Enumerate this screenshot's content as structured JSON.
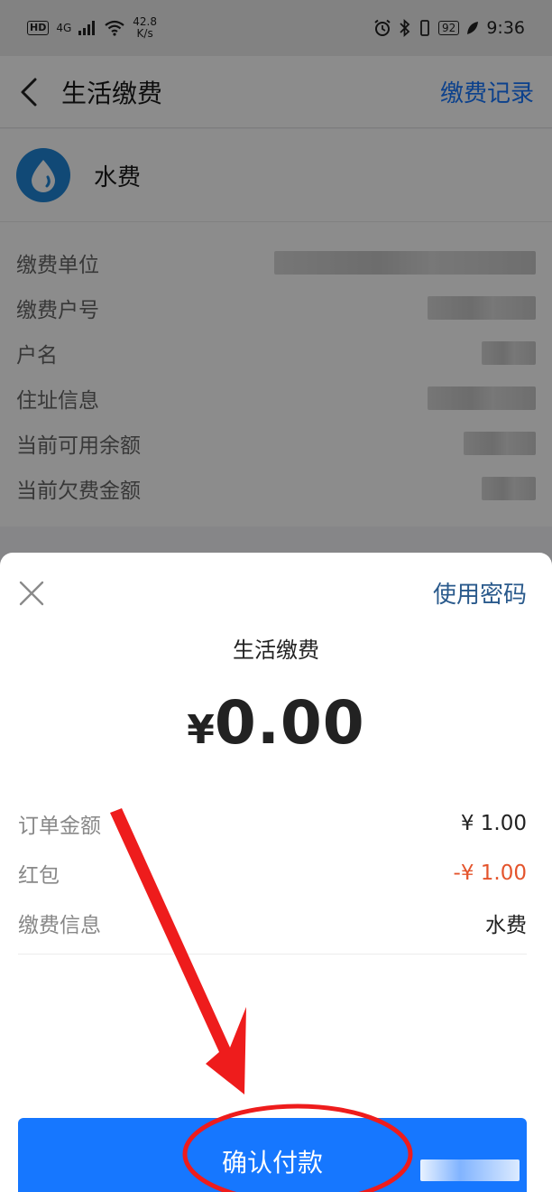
{
  "status_bar": {
    "hd": "HD",
    "net": "4G",
    "speed_value": "42.8",
    "speed_unit": "K/s",
    "battery": "92",
    "time": "9:36"
  },
  "header": {
    "title": "生活缴费",
    "records_link": "缴费记录"
  },
  "biller": {
    "name": "水费",
    "icon": "water-drop-icon"
  },
  "info_rows": [
    {
      "label": "缴费单位"
    },
    {
      "label": "缴费户号"
    },
    {
      "label": "户名"
    },
    {
      "label": "住址信息"
    },
    {
      "label": "当前可用余额"
    },
    {
      "label": "当前欠费金额"
    }
  ],
  "sheet": {
    "use_password": "使用密码",
    "title": "生活缴费",
    "currency": "¥",
    "amount": "0.00",
    "details": [
      {
        "label": "订单金额",
        "value": "¥ 1.00",
        "color": "#222222"
      },
      {
        "label": "红包",
        "value": "-¥ 1.00",
        "color": "#e4542c"
      },
      {
        "label": "缴费信息",
        "value": "水费",
        "color": "#222222"
      }
    ],
    "confirm_button": "确认付款"
  },
  "colors": {
    "primary": "#1677ff",
    "accent_red": "#e4542c",
    "annotation_red": "#ee1c1c"
  }
}
